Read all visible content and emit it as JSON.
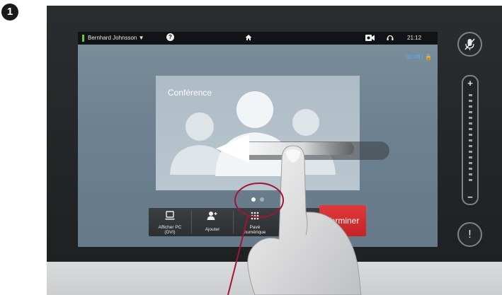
{
  "step": "1",
  "statusbar": {
    "user": "Bernhard Johnsson ▼",
    "help": "?",
    "clock": "21:12"
  },
  "call": {
    "timer": "00:08 | 🔒"
  },
  "conference": {
    "title": "Conférence"
  },
  "toolbar": {
    "items": [
      {
        "label_line1": "Afficher PC",
        "label_line2": "(DVI)"
      },
      {
        "label_line1": "Ajouter",
        "label_line2": ""
      },
      {
        "label_line1": "Pavé",
        "label_line2": "numérique"
      }
    ],
    "end_label": "Terminer"
  },
  "sidebar": {
    "volume_plus": "+",
    "volume_minus": "−",
    "alert": "!"
  },
  "pager": {
    "pages": 2,
    "active": 0
  },
  "colors": {
    "status_green": "#6dcc3c",
    "timer_blue": "#4fb2ff",
    "end_red": "#d42e30",
    "callout_red": "#a31437"
  }
}
